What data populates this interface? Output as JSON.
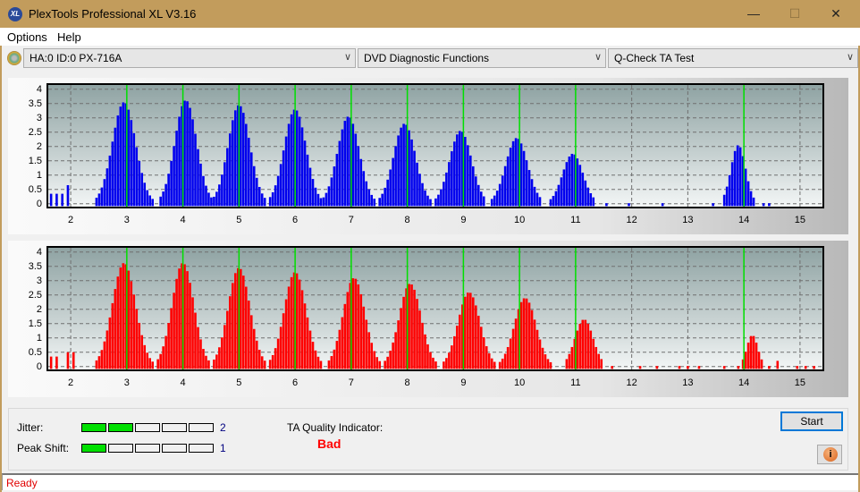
{
  "window": {
    "title": "PlexTools Professional XL V3.16",
    "app_icon_text": "XL",
    "minimize": "—",
    "maximize": "☐",
    "close": "✕"
  },
  "menu": {
    "items": [
      {
        "label": "Options"
      },
      {
        "label": "Help"
      }
    ]
  },
  "toolbar": {
    "drive": {
      "value": "HA:0 ID:0  PX-716A"
    },
    "function": {
      "value": "DVD Diagnostic Functions"
    },
    "test": {
      "value": "Q-Check TA Test"
    },
    "arrow": "∨"
  },
  "chart_data": [
    {
      "type": "bar",
      "name": "top-chart",
      "color": "#0000ee",
      "xlim": [
        1.6,
        15.4
      ],
      "ylim": [
        -0.1,
        4.15
      ],
      "yticks": [
        "4",
        "3.5",
        "3",
        "2.5",
        "2",
        "1.5",
        "1",
        "0.5",
        "0"
      ],
      "xticks": [
        "2",
        "3",
        "4",
        "5",
        "6",
        "7",
        "8",
        "9",
        "10",
        "11",
        "12",
        "13",
        "14",
        "15"
      ],
      "green_markers": [
        3,
        4,
        5,
        6,
        7,
        8,
        9,
        10,
        11,
        14
      ],
      "peaks": [
        {
          "center": 2.95,
          "height": 3.55,
          "width": 0.32
        },
        {
          "center": 4.05,
          "height": 3.62,
          "width": 0.3
        },
        {
          "center": 5.0,
          "height": 3.45,
          "width": 0.3
        },
        {
          "center": 6.0,
          "height": 3.3,
          "width": 0.3
        },
        {
          "center": 6.95,
          "height": 3.05,
          "width": 0.3
        },
        {
          "center": 7.95,
          "height": 2.8,
          "width": 0.3
        },
        {
          "center": 8.95,
          "height": 2.55,
          "width": 0.3
        },
        {
          "center": 9.95,
          "height": 2.3,
          "width": 0.3
        },
        {
          "center": 10.95,
          "height": 1.75,
          "width": 0.28
        },
        {
          "center": 13.9,
          "height": 2.05,
          "width": 0.2
        }
      ],
      "isolated": [
        [
          1.65,
          0.35
        ],
        [
          1.75,
          0.35
        ],
        [
          1.85,
          0.35
        ],
        [
          1.95,
          0.65
        ],
        [
          11.55,
          0.02
        ],
        [
          11.95,
          0.02
        ],
        [
          12.55,
          0.02
        ],
        [
          13.45,
          0.02
        ],
        [
          14.35,
          0.02
        ],
        [
          14.45,
          0.02
        ]
      ]
    },
    {
      "type": "bar",
      "name": "bottom-chart",
      "color": "#ff0000",
      "xlim": [
        1.6,
        15.4
      ],
      "ylim": [
        -0.1,
        4.15
      ],
      "yticks": [
        "4",
        "3.5",
        "3",
        "2.5",
        "2",
        "1.5",
        "1",
        "0.5",
        "0"
      ],
      "xticks": [
        "2",
        "3",
        "4",
        "5",
        "6",
        "7",
        "8",
        "9",
        "10",
        "11",
        "12",
        "13",
        "14",
        "15"
      ],
      "green_markers": [
        3,
        4,
        5,
        6,
        7,
        8,
        9,
        10,
        11,
        14
      ],
      "peaks": [
        {
          "center": 2.95,
          "height": 3.62,
          "width": 0.32
        },
        {
          "center": 4.0,
          "height": 3.62,
          "width": 0.3
        },
        {
          "center": 5.0,
          "height": 3.45,
          "width": 0.3
        },
        {
          "center": 6.0,
          "height": 3.3,
          "width": 0.3
        },
        {
          "center": 7.05,
          "height": 3.1,
          "width": 0.3
        },
        {
          "center": 8.05,
          "height": 2.9,
          "width": 0.3
        },
        {
          "center": 9.1,
          "height": 2.6,
          "width": 0.3
        },
        {
          "center": 10.1,
          "height": 2.4,
          "width": 0.3
        },
        {
          "center": 11.15,
          "height": 1.65,
          "width": 0.25
        },
        {
          "center": 14.15,
          "height": 1.1,
          "width": 0.15
        }
      ],
      "isolated": [
        [
          1.65,
          0.35
        ],
        [
          1.75,
          0.35
        ],
        [
          1.95,
          0.5
        ],
        [
          2.05,
          0.5
        ],
        [
          11.65,
          0.02
        ],
        [
          12.15,
          0.02
        ],
        [
          12.45,
          0.02
        ],
        [
          12.85,
          0.02
        ],
        [
          13.0,
          0.02
        ],
        [
          13.2,
          0.02
        ],
        [
          13.65,
          0.02
        ],
        [
          13.9,
          0.02
        ],
        [
          14.45,
          0.02
        ],
        [
          14.6,
          0.2
        ],
        [
          14.95,
          0.02
        ],
        [
          15.1,
          0.02
        ],
        [
          15.25,
          0.02
        ]
      ]
    }
  ],
  "results": {
    "jitter": {
      "label": "Jitter:",
      "value": "2",
      "level": 2,
      "max": 5
    },
    "peak_shift": {
      "label": "Peak Shift:",
      "value": "1",
      "level": 1,
      "max": 5
    },
    "ta_quality": {
      "label": "TA Quality Indicator:",
      "value": "Bad",
      "color": "#ff0000"
    }
  },
  "buttons": {
    "start": "Start",
    "info": "i"
  },
  "status": {
    "text": "Ready"
  }
}
